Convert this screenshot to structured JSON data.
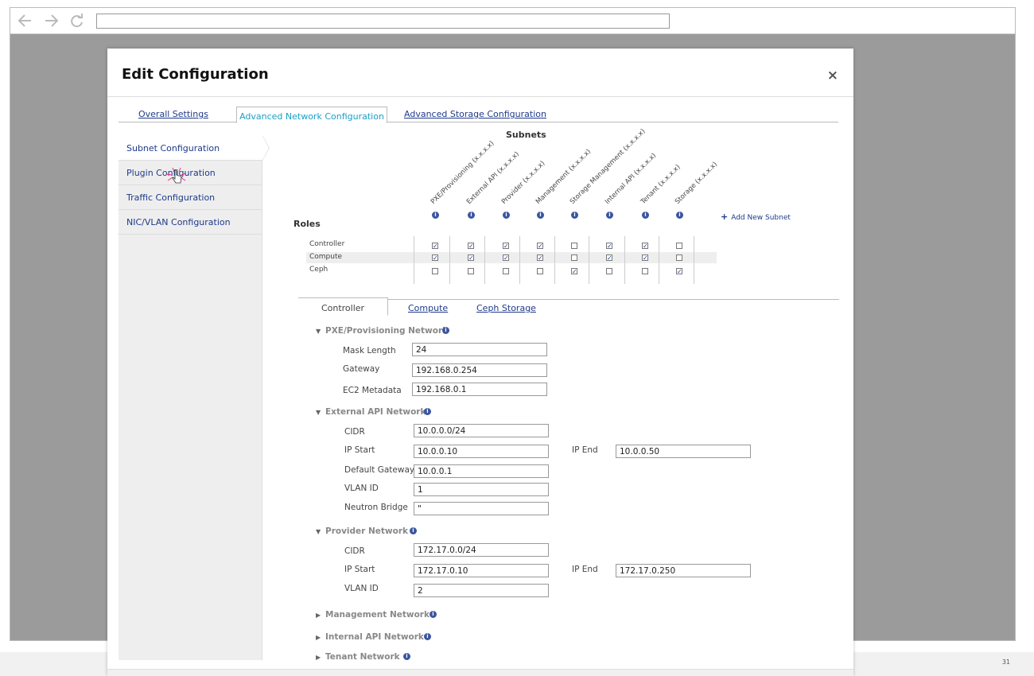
{
  "page": {
    "number": "31"
  },
  "modal": {
    "title": "Edit Configuration",
    "close_icon": "×"
  },
  "top_tabs": {
    "overall": "Overall Settings",
    "advanced_network": "Advanced Network Configuration",
    "advanced_storage": "Advanced Storage Configuration"
  },
  "left_nav": {
    "items": [
      "Subnet Configuration",
      "Plugin Configuration",
      "Traffic Configuration",
      "NIC/VLAN Configuration"
    ]
  },
  "subnets": {
    "title": "Subnets",
    "columns": [
      "PXE/Provisioning (x.x.x.x)",
      "External API (x.x.x.x)",
      "Provider (x.x.x.x)",
      "Management (x.x.x.x)",
      "Storage Management (x.x.x.x)",
      "Internal API (x.x.x.x)",
      "Tenant (x.x.x.x)",
      "Storage (x.x.x.x)"
    ],
    "add_subnet": "Add New Subnet",
    "add_icon": "+"
  },
  "roles": {
    "title": "Roles",
    "rows": [
      {
        "name": "Controller",
        "checks": [
          true,
          true,
          true,
          true,
          false,
          true,
          true,
          false
        ]
      },
      {
        "name": "Compute",
        "checks": [
          true,
          true,
          true,
          true,
          false,
          true,
          true,
          false
        ]
      },
      {
        "name": "Ceph",
        "checks": [
          false,
          false,
          false,
          false,
          true,
          false,
          false,
          true
        ]
      }
    ]
  },
  "role_tabs": {
    "controller": "Controller",
    "compute": "Compute",
    "ceph_storage": "Ceph Storage"
  },
  "sections": {
    "pxe": {
      "title": "PXE/Provisioning Network",
      "mask_length_label": "Mask Length",
      "mask_length": "24",
      "gateway_label": "Gateway",
      "gateway": "192.168.0.254",
      "ec2_label": "EC2 Metadata",
      "ec2": "192.168.0.1"
    },
    "external": {
      "title": "External API Network",
      "cidr_label": "CIDR",
      "cidr": "10.0.0.0/24",
      "ip_start_label": "IP Start",
      "ip_start": "10.0.0.10",
      "ip_end_label": "IP End",
      "ip_end": "10.0.0.50",
      "default_gateway_label": "Default Gateway",
      "default_gateway": "10.0.0.1",
      "vlan_label": "VLAN ID",
      "vlan": "1",
      "bridge_label": "Neutron Bridge",
      "bridge": "\""
    },
    "provider": {
      "title": "Provider Network",
      "cidr_label": "CIDR",
      "cidr": "172.17.0.0/24",
      "ip_start_label": "IP Start",
      "ip_start": "172.17.0.10",
      "ip_end_label": "IP End",
      "ip_end": "172.17.0.250",
      "vlan_label": "VLAN ID",
      "vlan": "2"
    },
    "management": {
      "title": "Management Network"
    },
    "internal_api": {
      "title": "Internal API Network"
    },
    "tenant": {
      "title": "Tenant Network"
    }
  },
  "icons": {
    "info": "i",
    "expanded": "▼",
    "collapsed": "▶",
    "back": "🡐",
    "forward": "🡒",
    "reload": "↻"
  }
}
